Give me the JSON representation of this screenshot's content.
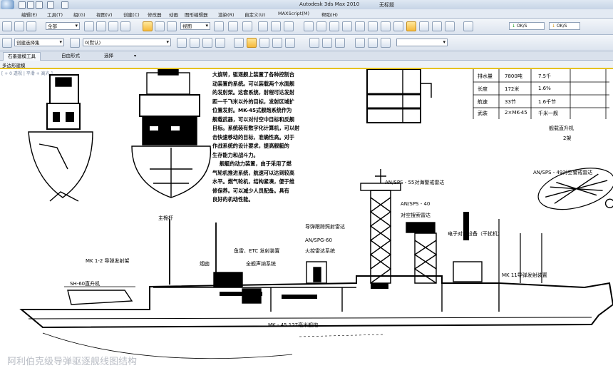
{
  "title_bar": {
    "app_title": "Autodesk 3ds Max 2010",
    "document_name": "无标题"
  },
  "menu": {
    "items": [
      "编辑(E)",
      "工具(T)",
      "组(G)",
      "视图(V)",
      "创建(C)",
      "修改器",
      "动画",
      "图形编辑器",
      "渲染(R)",
      "自定义(U)",
      "MAXScript(M)",
      "帮助(H)"
    ]
  },
  "toolbar1": {
    "filter_select": "全部",
    "coord_select": "视图",
    "status_ok1": "OK/S",
    "status_ok2": "OK/S"
  },
  "toolbar2": {
    "layer_select": "0(默认)",
    "selection_set": "创建选择集"
  },
  "ribbon": {
    "tabs": [
      "石墨建模工具",
      "自由形式",
      "选择"
    ],
    "sub_label": "多边形建模"
  },
  "viewport": {
    "label": "[ + 0 透视 | 平滑 + 高光 ]"
  },
  "drawing": {
    "paragraph_lines": [
      "大旋转，驱逐舰上装置了各种控制台",
      "动装置的系统。可以装载两个水面舰",
      "的发射架。这套系统，射程可达发射",
      "距一千飞米以外的目标，发射区域扩",
      "位置发射。MK-45式舰炮系统作为",
      "舰载武器，可以对付空中目标和反舰",
      "目标。系统装有数字化计算机，可以射",
      "击快速移动的目标，准确性高。对于",
      "作战系统的设计要求，提高舰艇的",
      "生存能力和战斗力。",
      "    舰艇的动力装置，由于采用了燃",
      "气轮机推进系统，航速可以达到较高",
      "水平。燃气轮机，结构紧凑，便于维",
      "修保养。可以减少人员配备。具有",
      "良好的机动性能。"
    ],
    "table_rows": [
      [
        "排水量",
        "7800吨",
        "7.5千"
      ],
      [
        "长度",
        "172米",
        "1.6%"
      ],
      [
        "航速",
        "33节",
        "1.6千节"
      ],
      [
        "武装",
        "2×MK-45",
        "千米一舰"
      ]
    ],
    "table_note": [
      "舰载直升机",
      "2架"
    ],
    "labels": {
      "top_right": "AN/SPS - 49对空警戒雷达",
      "radar1": "AN/SPS - 55对海警戒雷达",
      "radar2": "AN/SPS - 40",
      "radar3": "对空搜索雷达",
      "antenna": "导弹跟踪照射雷达",
      "mk_left": "MK 1-2 导弹发射架",
      "helicopter": "SH-60直升机",
      "mast": "主桅杆",
      "stack": "烟囱",
      "stack2": "主烟囱",
      "etc": "鱼雷、ETC 发射装置",
      "sonar": "全舰声纳系统",
      "mk_right": "MK 11导弹发射装置",
      "fire": "火控雷达",
      "fire2": "AN/SPG-60",
      "fire3": "火控雷达系统",
      "jammer": "电子对抗设备（干扰机）",
      "bottom": "MK - 45  127毫米舰炮",
      "bottom_blur": "阿利伯克级导弹驱逐舰线图结构"
    }
  },
  "colors": {
    "title_bar": "#c6d4e6",
    "toolbar": "#dbe3ee",
    "accent": "#e6c320",
    "active_tool": "#f5b93b"
  }
}
